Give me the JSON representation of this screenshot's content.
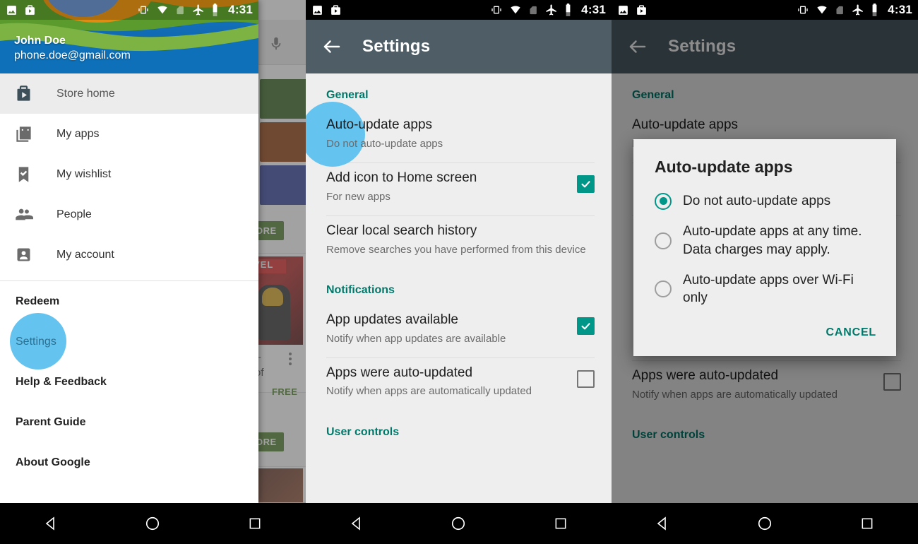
{
  "status_bar": {
    "time": "4:31",
    "icons_left": [
      "image-icon",
      "play-store-update-icon"
    ],
    "icons_right": [
      "vibrate-icon",
      "wifi-icon",
      "no-sim-icon",
      "airplane-mode-icon",
      "battery-icon"
    ]
  },
  "nav_bar": {
    "back": "back-triangle-icon",
    "home": "home-circle-icon",
    "recents": "recents-square-icon"
  },
  "panel1": {
    "drawer": {
      "account": {
        "name": "John Doe",
        "email": "phone.doe@gmail.com"
      },
      "items": [
        {
          "label": "Store home",
          "icon": "store-bag-icon",
          "selected": true
        },
        {
          "label": "My apps",
          "icon": "my-apps-icon",
          "selected": false
        },
        {
          "label": "My wishlist",
          "icon": "bookmark-check-icon",
          "selected": false
        },
        {
          "label": "People",
          "icon": "people-icon",
          "selected": false
        },
        {
          "label": "My account",
          "icon": "account-icon",
          "selected": false
        }
      ],
      "secondary_items": [
        {
          "label": "Redeem",
          "tapped": false
        },
        {
          "label": "Settings",
          "tapped": true
        },
        {
          "label": "Help & Feedback",
          "tapped": false
        },
        {
          "label": "Parent Guide",
          "tapped": false
        },
        {
          "label": "About Google",
          "tapped": false
        }
      ]
    },
    "store_background": {
      "search_mic": "microphone-icon",
      "more_chip_1": "ORE",
      "more_chip_2": "ORE",
      "card_title_fragment": "of",
      "card_price": "FREE"
    }
  },
  "panel2": {
    "toolbar": {
      "back": "back-arrow-icon",
      "title": "Settings"
    },
    "sections": [
      {
        "header": "General",
        "rows": [
          {
            "title": "Auto-update apps",
            "subtitle": "Do not auto-update apps",
            "control": "none",
            "tapped": true
          },
          {
            "title": "Add icon to Home screen",
            "subtitle": "For new apps",
            "control": "checkbox-on",
            "tapped": false
          },
          {
            "title": "Clear local search history",
            "subtitle": "Remove searches you have performed from this device",
            "control": "none",
            "tapped": false
          }
        ]
      },
      {
        "header": "Notifications",
        "rows": [
          {
            "title": "App updates available",
            "subtitle": "Notify when app updates are available",
            "control": "checkbox-on",
            "tapped": false
          },
          {
            "title": "Apps were auto-updated",
            "subtitle": "Notify when apps are automatically updated",
            "control": "checkbox-off",
            "tapped": false
          }
        ]
      },
      {
        "header": "User controls",
        "rows": []
      }
    ]
  },
  "panel3": {
    "toolbar": {
      "back": "back-arrow-icon",
      "title": "Settings"
    },
    "sections": [
      {
        "header": "General",
        "rows": [
          {
            "title": "Auto-update apps",
            "subtitle": "Do not auto-update apps",
            "control": "none"
          }
        ]
      },
      {
        "header": "",
        "rows": [
          {
            "title": "Apps were auto-updated",
            "subtitle": "Notify when apps are automatically updated",
            "control": "checkbox-off"
          }
        ]
      },
      {
        "header": "User controls",
        "rows": []
      }
    ],
    "dialog": {
      "title": "Auto-update apps",
      "options": [
        {
          "label": "Do not auto-update apps",
          "selected": true
        },
        {
          "label": "Auto-update apps at any time. Data charges may apply.",
          "selected": false
        },
        {
          "label": "Auto-update apps over Wi-Fi only",
          "selected": false
        }
      ],
      "cancel_label": "CANCEL"
    }
  },
  "colors": {
    "toolbar": "#4e5d66",
    "accent_teal": "#009688",
    "section_header": "#00796b",
    "tap_highlight": "#64c3ef",
    "dialog_bg": "#eeeeee",
    "settings_bg": "#eeeeee"
  }
}
